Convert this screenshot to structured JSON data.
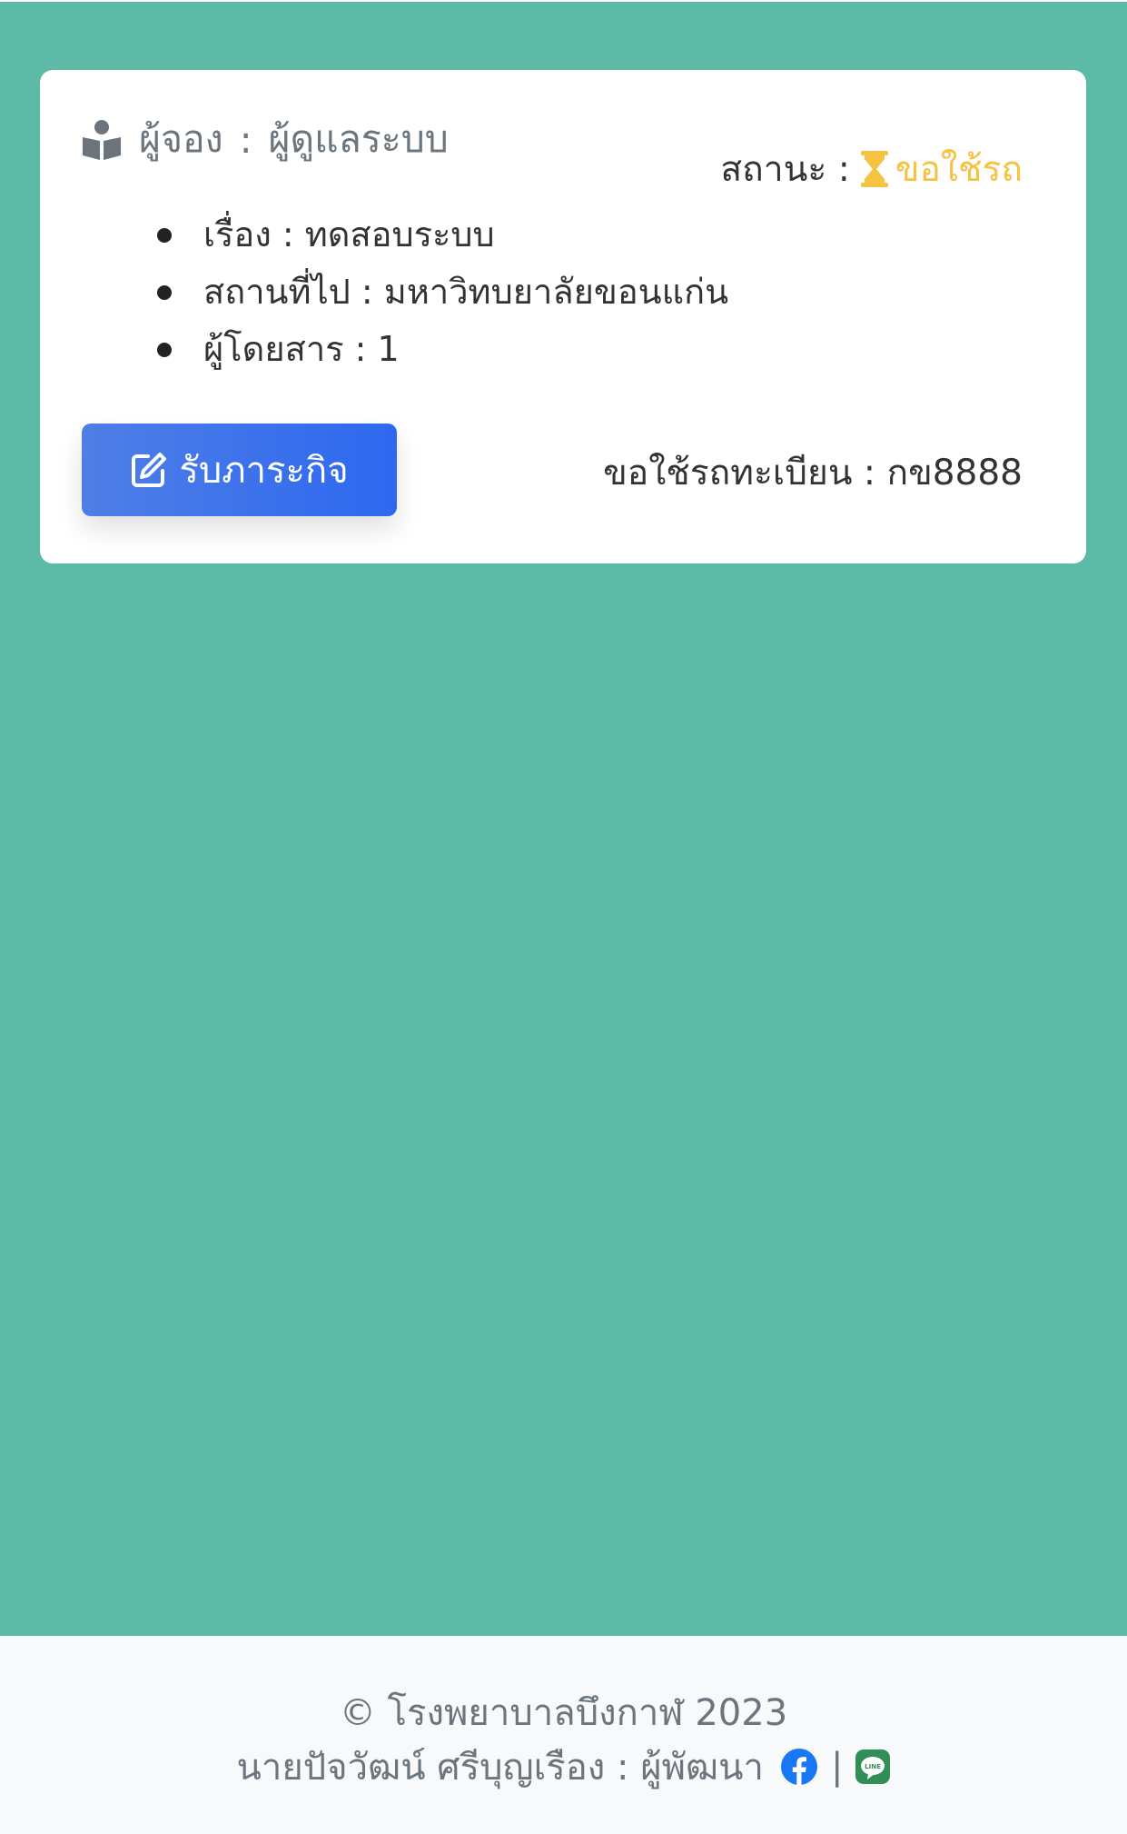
{
  "booking": {
    "booker_label": "ผู้จอง",
    "booker_name": "ผู้ดูแลระบบ",
    "status_label": "สถานะ :",
    "status_value": "ขอใช้รถ",
    "details": [
      {
        "label": "เรื่อง : ",
        "value": "ทดสอบระบบ"
      },
      {
        "label": "สถานที่ไป : ",
        "value": "มหาวิทบยาลัยขอนแก่น"
      },
      {
        "label": "ผู้โดยสาร : ",
        "value": "1"
      }
    ],
    "accept_button": "รับภาระกิจ",
    "plate_label": "ขอใช้รถทะเบียน : ",
    "plate_value": "กข8888"
  },
  "footer": {
    "copyright": "© โรงพยาบาลบึงกาฬ 2023",
    "developer": "นายปัจวัฒน์ ศรีบุญเรือง : ผู้พัฒนา",
    "separator": "|"
  },
  "icons": {
    "booker": "book-reader-icon",
    "status": "hourglass-icon",
    "button": "edit-icon",
    "facebook": "facebook-icon",
    "line": "line-icon"
  },
  "colors": {
    "background": "#5dbaa6",
    "status": "#f5c242",
    "button": "#2d68f0",
    "facebook": "#1877f2",
    "line": "#2f8f57"
  }
}
